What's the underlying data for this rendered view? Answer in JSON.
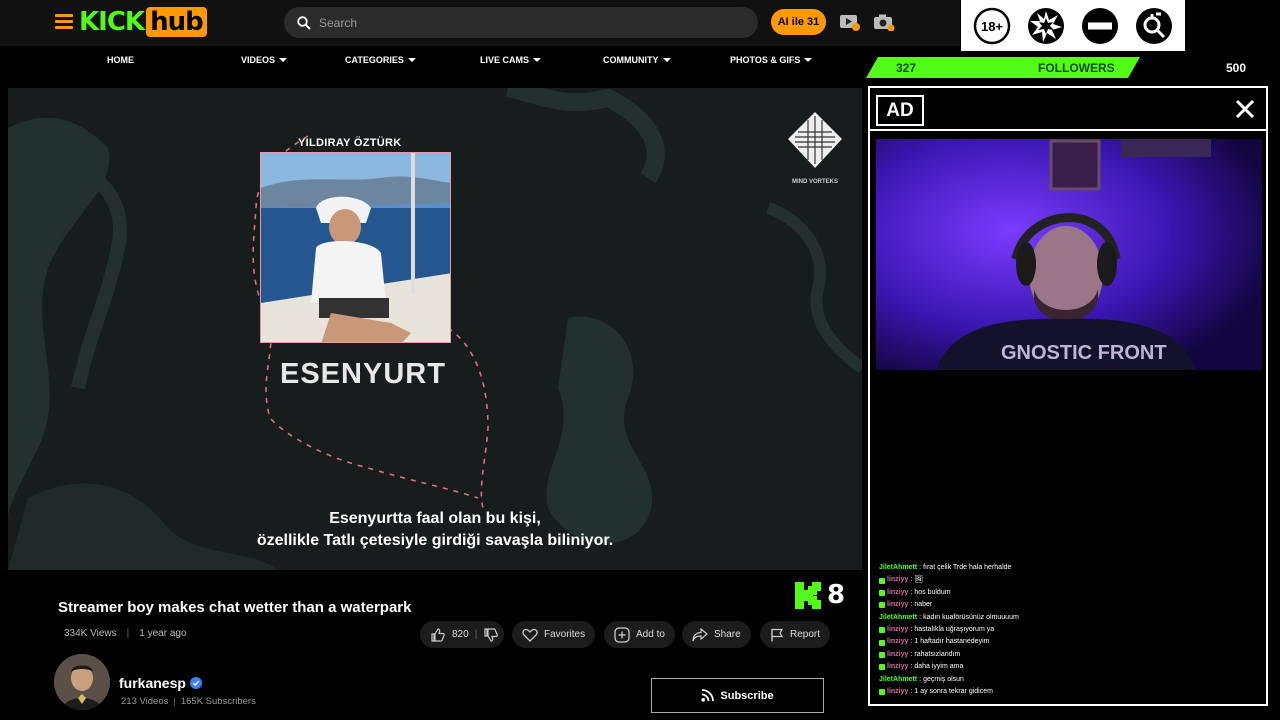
{
  "header": {
    "logo_part1": "KICK",
    "logo_part2": "hub",
    "search_placeholder": "Search",
    "ai_button": "AI ile 31",
    "icons": [
      "menu-icon",
      "video-upload-icon",
      "camera-icon"
    ]
  },
  "ratings": [
    "18-plus-icon",
    "explosion-icon",
    "no-entry-icon",
    "gender-search-icon"
  ],
  "nav": [
    {
      "label": "HOME",
      "dropdown": false
    },
    {
      "label": "VIDEOS",
      "dropdown": true
    },
    {
      "label": "CATEGORIES",
      "dropdown": true
    },
    {
      "label": "LIVE CAMS",
      "dropdown": true
    },
    {
      "label": "COMMUNITY",
      "dropdown": true
    },
    {
      "label": "PHOTOS & GIFS",
      "dropdown": true
    }
  ],
  "followers": {
    "current": "327",
    "label": "FOLLOWERS",
    "goal": "500",
    "progress": 0.654
  },
  "video": {
    "person_name": "YILDIRAY ÖZTÜRK",
    "place": "ESENYURT",
    "brand_label": "MIND VORTEKS",
    "subtitle_line1": "Esenyurtta faal olan bu kişi,",
    "subtitle_line2": "özellikle Tatlı çetesiyle girdiği savaşla biliniyor."
  },
  "title": "Streamer boy makes chat wetter than a waterpark",
  "kick_count": "8",
  "meta": {
    "views": "334K Views",
    "age": "1 year ago"
  },
  "actions": {
    "likes": "820",
    "favorites": "Favorites",
    "add_to": "Add to",
    "share": "Share",
    "report": "Report"
  },
  "channel": {
    "name": "furkanesp",
    "videos": "213 Videos",
    "subscribers": "165K Subscribers",
    "subscribe_label": "Subscribe"
  },
  "ad": {
    "label": "AD",
    "webcam_shirt_text": "GNOSTIC FRONT"
  },
  "chat": [
    {
      "user": "JiletAhmett",
      "color": "green",
      "badge": false,
      "msg": "fırat çelik Trde hala herhalde"
    },
    {
      "user": "linziyy",
      "color": "pink",
      "badge": true,
      "msg": "🖼"
    },
    {
      "user": "linziyy",
      "color": "pink",
      "badge": true,
      "msg": "hos buldum"
    },
    {
      "user": "linziyy",
      "color": "pink",
      "badge": true,
      "msg": "naber"
    },
    {
      "user": "JiletAhmett",
      "color": "green",
      "badge": false,
      "msg": "kadın kuaförüsünüz olmuuuum"
    },
    {
      "user": "linziyy",
      "color": "pink",
      "badge": true,
      "msg": "hastalıkla uğraşıyorum ya"
    },
    {
      "user": "linziyy",
      "color": "pink",
      "badge": true,
      "msg": "1 haftadır hastanedeyim"
    },
    {
      "user": "linziyy",
      "color": "pink",
      "badge": true,
      "msg": "rahatsızlandım"
    },
    {
      "user": "linziyy",
      "color": "pink",
      "badge": true,
      "msg": "daha iyyim ama"
    },
    {
      "user": "JiletAhmett",
      "color": "green",
      "badge": false,
      "msg": "geçmiş olsun"
    },
    {
      "user": "linziyy",
      "color": "pink",
      "badge": true,
      "msg": "1 ay sonra tekrar gidicem"
    }
  ]
}
